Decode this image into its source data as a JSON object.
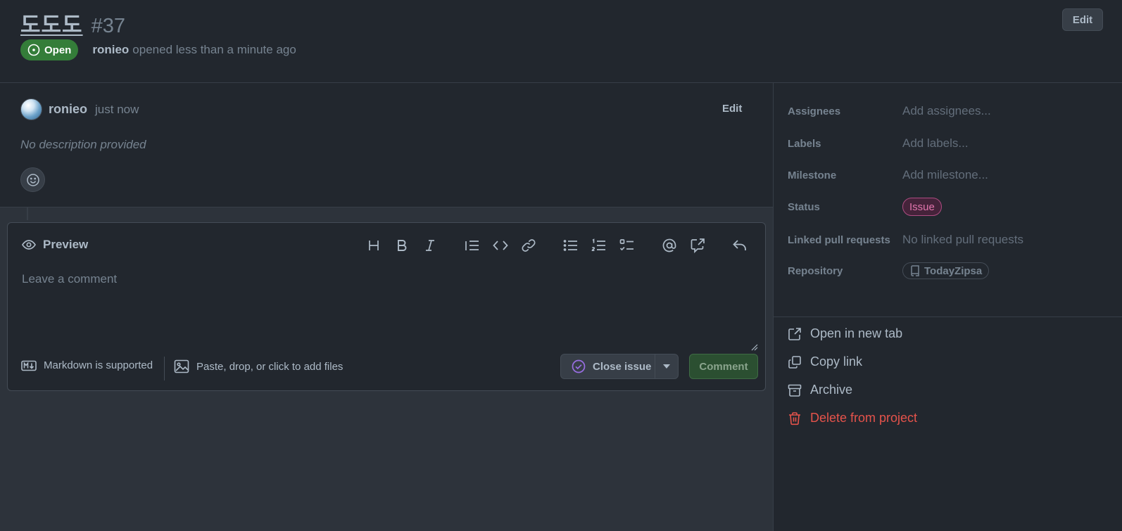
{
  "issue": {
    "title": "도도도",
    "number": "#37",
    "edit_label": "Edit",
    "state_label": "Open",
    "author": "ronieo",
    "opened_text": "opened less than a minute ago"
  },
  "comment": {
    "author": "ronieo",
    "time": "just now",
    "edit_label": "Edit",
    "body_placeholder": "No description provided"
  },
  "editor": {
    "preview_label": "Preview",
    "placeholder": "Leave a comment",
    "markdown_hint": "Markdown is supported",
    "files_hint": "Paste, drop, or click to add files",
    "close_label": "Close issue",
    "comment_label": "Comment"
  },
  "sidebar": {
    "fields": [
      {
        "label": "Assignees",
        "value": "Add assignees..."
      },
      {
        "label": "Labels",
        "value": "Add labels..."
      },
      {
        "label": "Milestone",
        "value": "Add milestone..."
      },
      {
        "label": "Status",
        "value": "Issue"
      },
      {
        "label": "Linked pull requests",
        "value": "No linked pull requests"
      },
      {
        "label": "Repository",
        "value": "TodayZipsa"
      }
    ],
    "actions": [
      {
        "label": "Open in new tab",
        "icon": "external-link-icon"
      },
      {
        "label": "Copy link",
        "icon": "copy-icon"
      },
      {
        "label": "Archive",
        "icon": "archive-icon"
      },
      {
        "label": "Delete from project",
        "icon": "trash-icon"
      }
    ]
  },
  "colors": {
    "background": "#22272e",
    "open_green": "#347d39",
    "status_pink": "#e275ad",
    "danger_red": "#e5534b",
    "close_purple": "#986ee2"
  }
}
